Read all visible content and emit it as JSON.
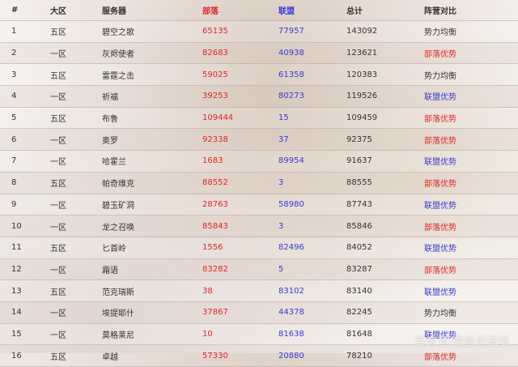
{
  "colors": {
    "horde": "#e02828",
    "alliance": "#3a3ad6"
  },
  "headers": {
    "rank": "#",
    "region": "大区",
    "server": "服务器",
    "horde": "部落",
    "alliance": "联盟",
    "total": "总计",
    "faction": "阵营对比"
  },
  "rows": [
    {
      "rank": "1",
      "region": "五区",
      "server": "碧空之歌",
      "horde": "65135",
      "alliance": "77957",
      "total": "143092",
      "faction": "势力均衡"
    },
    {
      "rank": "2",
      "region": "一区",
      "server": "灰烬使者",
      "horde": "82683",
      "alliance": "40938",
      "total": "123621",
      "faction": "部落优势"
    },
    {
      "rank": "3",
      "region": "五区",
      "server": "雷霆之击",
      "horde": "59025",
      "alliance": "61358",
      "total": "120383",
      "faction": "势力均衡"
    },
    {
      "rank": "4",
      "region": "一区",
      "server": "祈福",
      "horde": "39253",
      "alliance": "80273",
      "total": "119526",
      "faction": "联盟优势"
    },
    {
      "rank": "5",
      "region": "五区",
      "server": "布鲁",
      "horde": "109444",
      "alliance": "15",
      "total": "109459",
      "faction": "部落优势"
    },
    {
      "rank": "6",
      "region": "一区",
      "server": "奥罗",
      "horde": "92338",
      "alliance": "37",
      "total": "92375",
      "faction": "部落优势"
    },
    {
      "rank": "7",
      "region": "一区",
      "server": "哈霍兰",
      "horde": "1683",
      "alliance": "89954",
      "total": "91637",
      "faction": "联盟优势"
    },
    {
      "rank": "8",
      "region": "五区",
      "server": "帕奇维克",
      "horde": "88552",
      "alliance": "3",
      "total": "88555",
      "faction": "部落优势"
    },
    {
      "rank": "9",
      "region": "一区",
      "server": "碧玉矿洞",
      "horde": "28763",
      "alliance": "58980",
      "total": "87743",
      "faction": "联盟优势"
    },
    {
      "rank": "10",
      "region": "一区",
      "server": "龙之召唤",
      "horde": "85843",
      "alliance": "3",
      "total": "85846",
      "faction": "部落优势"
    },
    {
      "rank": "11",
      "region": "五区",
      "server": "匕首岭",
      "horde": "1556",
      "alliance": "82496",
      "total": "84052",
      "faction": "联盟优势"
    },
    {
      "rank": "12",
      "region": "一区",
      "server": "霜语",
      "horde": "83282",
      "alliance": "5",
      "total": "83287",
      "faction": "部落优势"
    },
    {
      "rank": "13",
      "region": "五区",
      "server": "范克瑞斯",
      "horde": "38",
      "alliance": "83102",
      "total": "83140",
      "faction": "联盟优势"
    },
    {
      "rank": "14",
      "region": "一区",
      "server": "埃提耶什",
      "horde": "37867",
      "alliance": "44378",
      "total": "82245",
      "faction": "势力均衡"
    },
    {
      "rank": "15",
      "region": "一区",
      "server": "莫格莱尼",
      "horde": "10",
      "alliance": "81638",
      "total": "81648",
      "faction": "联盟优势"
    },
    {
      "rank": "16",
      "region": "五区",
      "server": "卓越",
      "horde": "57330",
      "alliance": "20880",
      "total": "78210",
      "faction": "部落优势"
    }
  ],
  "watermark": "百家号/魔兽熊猫猫"
}
